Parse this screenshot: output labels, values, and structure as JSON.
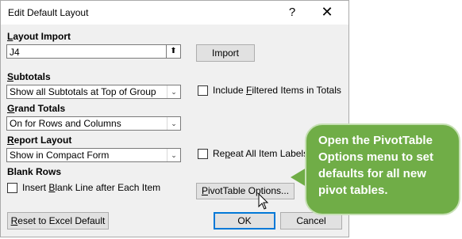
{
  "dialog": {
    "title": "Edit Default Layout",
    "help_glyph": "?",
    "close_glyph": "✕"
  },
  "layout_import": {
    "label_u": "L",
    "label_rest": "ayout Import",
    "value": "J4",
    "collapse_glyph": "⬆",
    "import_button": "Import"
  },
  "subtotals": {
    "label_u": "S",
    "label_rest": "ubtotals",
    "value": "Show all Subtotals at Top of Group"
  },
  "include_filtered": {
    "label_pre": "Include ",
    "label_u": "F",
    "label_rest": "iltered Items in Totals",
    "checked": false
  },
  "grand_totals": {
    "label_u": "G",
    "label_rest": "rand Totals",
    "value": "On for Rows and Columns"
  },
  "report_layout": {
    "label_u": "R",
    "label_rest": "eport Layout",
    "value": "Show in Compact Form"
  },
  "repeat_labels": {
    "label_pre": "Re",
    "label_u": "p",
    "label_rest": "eat All Item Labels",
    "checked": false
  },
  "blank_rows": {
    "label": "Blank Rows",
    "checkbox_pre": "Insert ",
    "checkbox_u": "B",
    "checkbox_rest": "lank Line after Each Item",
    "checked": false
  },
  "pivot_options_button": {
    "u": "P",
    "rest": "ivotTable Options..."
  },
  "reset_button": {
    "u": "R",
    "rest": "eset to Excel Default"
  },
  "ok_button": "OK",
  "cancel_button": "Cancel",
  "callout": {
    "text": "Open the PivotTable Options menu to set defaults for all new pivot tables.",
    "color": "#70ad47"
  },
  "dropdown_arrow": "⌄"
}
